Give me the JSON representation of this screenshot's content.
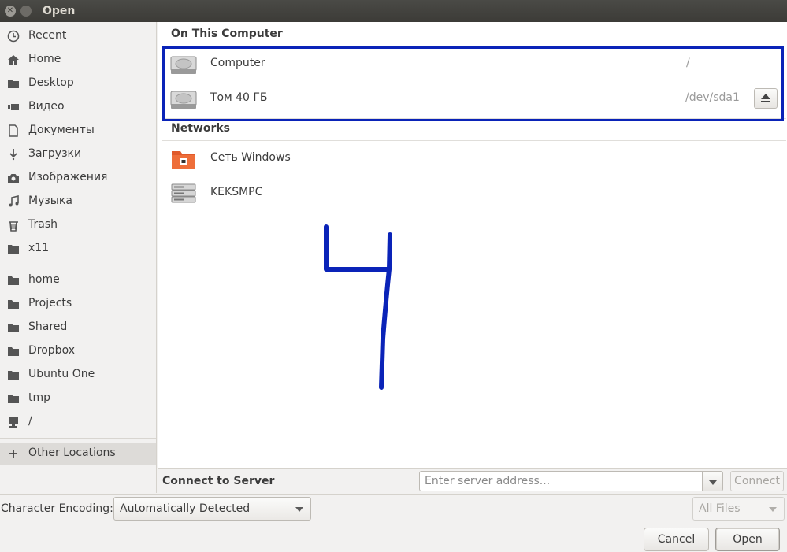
{
  "window": {
    "title": "Open"
  },
  "sidebar": {
    "items": [
      {
        "label": "Recent",
        "icon": "clock-icon"
      },
      {
        "label": "Home",
        "icon": "home-icon"
      },
      {
        "label": "Desktop",
        "icon": "folder-icon"
      },
      {
        "label": "Видео",
        "icon": "video-icon"
      },
      {
        "label": "Документы",
        "icon": "document-icon"
      },
      {
        "label": "Загрузки",
        "icon": "download-icon"
      },
      {
        "label": "Изображения",
        "icon": "camera-icon"
      },
      {
        "label": "Музыка",
        "icon": "music-icon"
      },
      {
        "label": "Trash",
        "icon": "trash-icon"
      },
      {
        "label": "x11",
        "icon": "folder-icon"
      }
    ],
    "bookmarks": [
      {
        "label": "home",
        "icon": "folder-icon"
      },
      {
        "label": "Projects",
        "icon": "folder-icon"
      },
      {
        "label": "Shared",
        "icon": "folder-icon"
      },
      {
        "label": "Dropbox",
        "icon": "folder-icon"
      },
      {
        "label": "Ubuntu One",
        "icon": "folder-icon"
      },
      {
        "label": "tmp",
        "icon": "folder-icon"
      },
      {
        "label": "/",
        "icon": "computer-icon"
      }
    ],
    "other_locations": {
      "label": "Other Locations",
      "icon": "plus-icon"
    }
  },
  "main": {
    "on_this_computer": {
      "heading": "On This Computer",
      "rows": [
        {
          "name": "Computer",
          "path": "/",
          "icon": "harddisk-icon"
        },
        {
          "name": "Том 40 ГБ",
          "path": "/dev/sda1",
          "icon": "harddisk-icon",
          "eject_icon": "eject-icon"
        }
      ]
    },
    "networks": {
      "heading": "Networks",
      "rows": [
        {
          "name": "Сеть Windows",
          "icon": "network-folder-icon"
        },
        {
          "name": "KEKSMPC",
          "icon": "server-icon"
        }
      ]
    },
    "highlight_color": "#0a23b8",
    "annotation_color": "#0a23b8"
  },
  "connect": {
    "label": "Connect to Server",
    "placeholder": "Enter server address...",
    "button": "Connect"
  },
  "encoding": {
    "label": "Character Encoding:",
    "value": "Automatically Detected",
    "filter": "All Files"
  },
  "actions": {
    "cancel": "Cancel",
    "open": "Open"
  }
}
